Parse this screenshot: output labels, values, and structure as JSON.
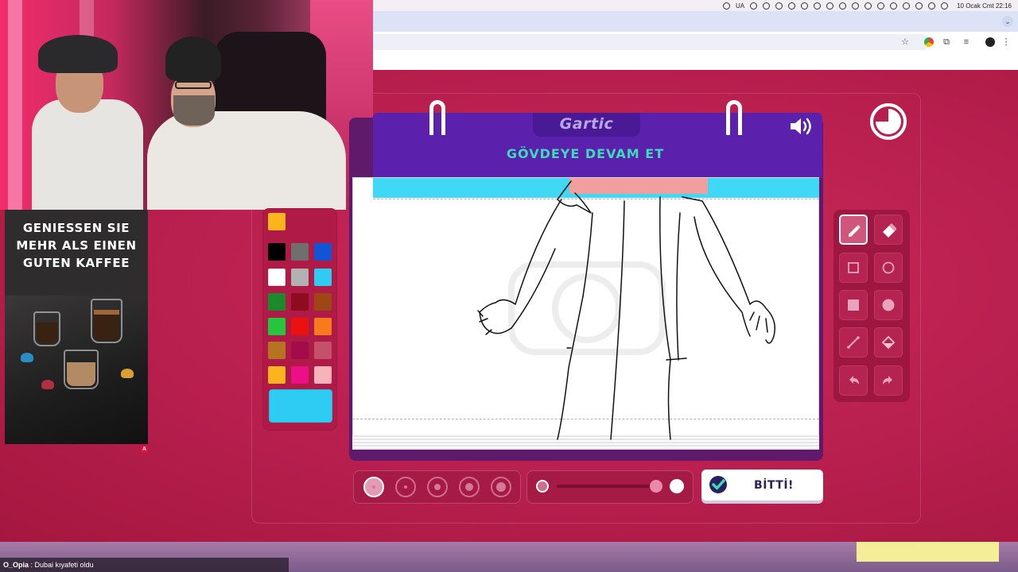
{
  "menubar": {
    "input_source": "UA",
    "clock": "10 Ocak Cmt  22:16"
  },
  "game": {
    "logo": "Gartic",
    "prompt": "GÖVDEYE DEVAM ET",
    "done_label": "BİTTİ!",
    "current_color": "#f9b51b",
    "selected_color": "#2ecbf3",
    "palette": [
      [
        "#000000",
        "#6f6f6f",
        "#1055d6"
      ],
      [
        "#ffffff",
        "#b2b2b2",
        "#2ecbf3"
      ],
      [
        "#1a8a2b",
        "#8d0c1e",
        "#9c4714"
      ],
      [
        "#26c53e",
        "#ec1111",
        "#f77a1d"
      ],
      [
        "#b67322",
        "#a30b4b",
        "#c5506a"
      ],
      [
        "#f9b51b",
        "#ec0f87",
        "#f8b2b9"
      ]
    ],
    "tools": [
      {
        "name": "pencil-tool",
        "icon": "pencil-icon",
        "active": true
      },
      {
        "name": "eraser-tool",
        "icon": "eraser-icon",
        "active": false
      },
      {
        "name": "rectangle-tool",
        "icon": "rectangle-outline-icon",
        "active": false
      },
      {
        "name": "ellipse-tool",
        "icon": "circle-outline-icon",
        "active": false
      },
      {
        "name": "filled-rectangle-tool",
        "icon": "filled-square-icon",
        "active": false
      },
      {
        "name": "filled-ellipse-tool",
        "icon": "filled-circle-icon",
        "active": false
      },
      {
        "name": "line-tool",
        "icon": "line-icon",
        "active": false
      },
      {
        "name": "fill-tool",
        "icon": "bucket-icon",
        "active": false
      },
      {
        "name": "undo-tool",
        "icon": "undo-icon",
        "active": false
      },
      {
        "name": "redo-tool",
        "icon": "redo-icon",
        "active": false
      }
    ],
    "brush_size_selected": 1
  },
  "ad": {
    "headline_line1": "GENIESSEN SIE",
    "headline_line2": "MEHR ALS EINEN",
    "headline_line3": "GUTEN KAFFEE",
    "badge": "A"
  },
  "chat": {
    "user": "O_Opia",
    "separator": " : ",
    "message": "Dubai kıyafeti oldu"
  }
}
